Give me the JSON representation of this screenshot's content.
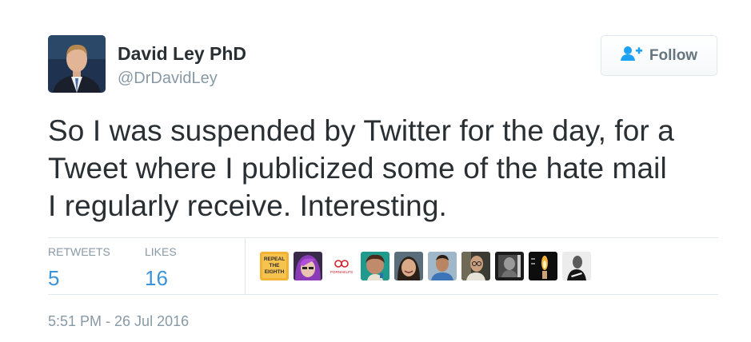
{
  "author": {
    "display_name": "David Ley PhD",
    "screen_name": "@DrDavidLey"
  },
  "follow_button": {
    "label": "Follow",
    "icon": "follow-person-plus-icon",
    "color": "#1da1f2"
  },
  "tweet": {
    "lines": [
      "So I was suspended by Twitter for the day, for a",
      "Tweet where I publicized some of the hate mail",
      "I regularly receive. Interesting."
    ],
    "timestamp": "5:51 PM - 26 Jul 2016"
  },
  "stats": {
    "retweets_label": "RETWEETS",
    "retweets_value": "5",
    "likes_label": "LIKES",
    "likes_value": "16"
  },
  "liker_avatars": [
    {
      "name": "repeal-the-eighth-avatar",
      "text_lines": [
        "REPEAL",
        "THE",
        "EIGHTH"
      ]
    },
    {
      "name": "purple-hair-avatar"
    },
    {
      "name": "pornhelps-avatar",
      "text": "PORNHELPS"
    },
    {
      "name": "teal-portrait-avatar"
    },
    {
      "name": "smiling-woman-avatar"
    },
    {
      "name": "man-blue-shirt-avatar"
    },
    {
      "name": "man-glasses-avatar"
    },
    {
      "name": "bw-photo-avatar"
    },
    {
      "name": "candle-avatar"
    },
    {
      "name": "bw-speaker-avatar"
    }
  ]
}
